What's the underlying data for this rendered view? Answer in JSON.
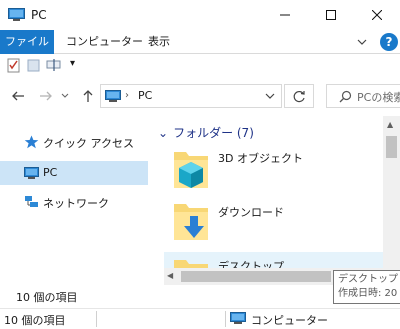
{
  "window": {
    "title": "PC",
    "icons": {
      "title": "computer-icon",
      "minimize": "minimize-icon",
      "maximize": "maximize-icon",
      "close": "close-icon"
    }
  },
  "ribbon": {
    "tabs": [
      {
        "label": "ファイル",
        "active": true
      },
      {
        "label": "コンピューター"
      },
      {
        "label": "表示"
      }
    ],
    "accent": "#1979ca",
    "help_label": "?"
  },
  "quick_access": {
    "icons": [
      "properties-icon",
      "new-folder-icon",
      "rename-icon",
      "customize-dropdown-icon"
    ],
    "dropdown_glyph": "▾"
  },
  "navigation": {
    "address": {
      "path": "PC",
      "icon": "computer-icon"
    },
    "search_placeholder": "PCの検索"
  },
  "nav_pane": {
    "items": [
      {
        "label": "クイック アクセス",
        "icon": "star-icon"
      },
      {
        "label": "PC",
        "icon": "computer-icon",
        "selected": true
      },
      {
        "label": "ネットワーク",
        "icon": "network-icon"
      }
    ],
    "item_count": "10 個の項目"
  },
  "content": {
    "group_title": "フォルダー (7)",
    "items": [
      {
        "label": "3D オブジェクト",
        "icon": "3d-objects-folder-icon"
      },
      {
        "label": "ダウンロード",
        "icon": "downloads-folder-icon"
      },
      {
        "label": "デスクトップ",
        "icon": "desktop-folder-icon",
        "hovered": true
      }
    ]
  },
  "tooltip": {
    "line1": "デスクトップ",
    "line2": "作成日時: 20"
  },
  "status_bar": {
    "count": "10 個の項目",
    "location": "コンピューター"
  },
  "colors": {
    "selection": "#cce4f7",
    "hover": "#e5f3fb",
    "group_header": "#1e3287",
    "folder": "#f8d775"
  }
}
